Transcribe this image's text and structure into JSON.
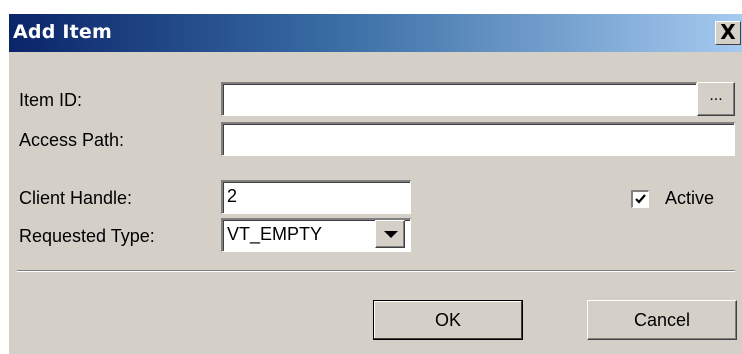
{
  "window": {
    "title": "Add Item",
    "close_glyph": "X"
  },
  "form": {
    "item_id": {
      "label": "Item ID:",
      "value": "",
      "browse_label": "..."
    },
    "access_path": {
      "label": "Access Path:",
      "value": ""
    },
    "client_handle": {
      "label": "Client Handle:",
      "value": "2"
    },
    "active": {
      "label": "Active",
      "checked": true
    },
    "requested_type": {
      "label": "Requested Type:",
      "value": "VT_EMPTY"
    }
  },
  "buttons": {
    "ok_label": "OK",
    "cancel_label": "Cancel"
  },
  "icons": {
    "close": "close-icon",
    "dropdown": "chevron-down-icon",
    "check": "checkmark-icon"
  },
  "colors": {
    "titlebar_start": "#0a246a",
    "titlebar_end": "#a6caf0",
    "dialog_bg": "#d4d0c8"
  }
}
